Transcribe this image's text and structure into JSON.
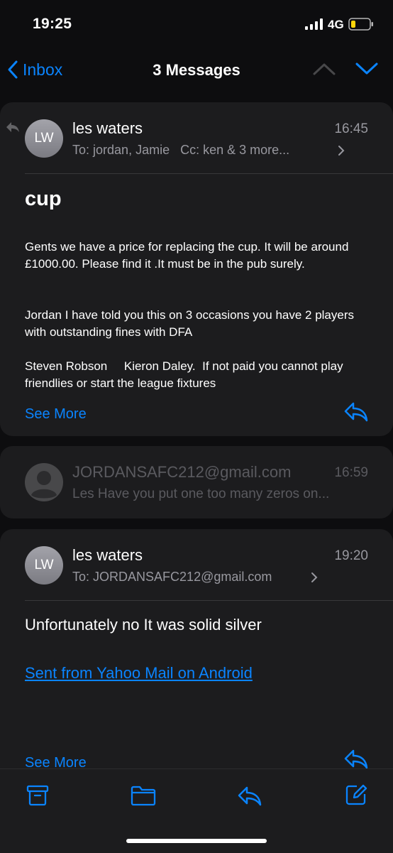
{
  "status": {
    "time": "19:25",
    "network": "4G"
  },
  "nav": {
    "back_label": "Inbox",
    "title": "3 Messages"
  },
  "messages": [
    {
      "initials": "LW",
      "sender": "les waters",
      "time": "16:45",
      "to_label": "To:",
      "to": "jordan, Jamie",
      "cc_label": "Cc:",
      "cc": "ken & 3 more...",
      "subject": "cup",
      "body": [
        "Gents we have a price for replacing the cup. It will be around £1000.00. Please find it .It must be in the pub surely.",
        "Jordan I have told you this on 3 occasions you have 2 players with outstanding fines with DFA",
        "Steven Robson     Kieron Daley.  If not paid you cannot play friendlies or start the league fixtures"
      ],
      "see_more": "See More"
    },
    {
      "sender": "JORDANSAFC212@gmail.com",
      "time": "16:59",
      "preview": "Les Have you put one too many zeros on..."
    },
    {
      "initials": "LW",
      "sender": "les waters",
      "time": "19:20",
      "to_label": "To:",
      "to": "JORDANSAFC212@gmail.com",
      "body": "Unfortunately no It was solid silver",
      "link": "Sent from Yahoo Mail on Android",
      "see_more": "See More"
    }
  ],
  "colors": {
    "accent": "#0a84ff",
    "card": "#1c1c1e",
    "background": "#0d0d0f"
  },
  "icons": [
    "signal-icon",
    "battery-icon",
    "back-chevron-icon",
    "chevron-up-icon",
    "chevron-down-icon",
    "reply-icon",
    "archive-icon",
    "folder-icon",
    "compose-icon"
  ]
}
